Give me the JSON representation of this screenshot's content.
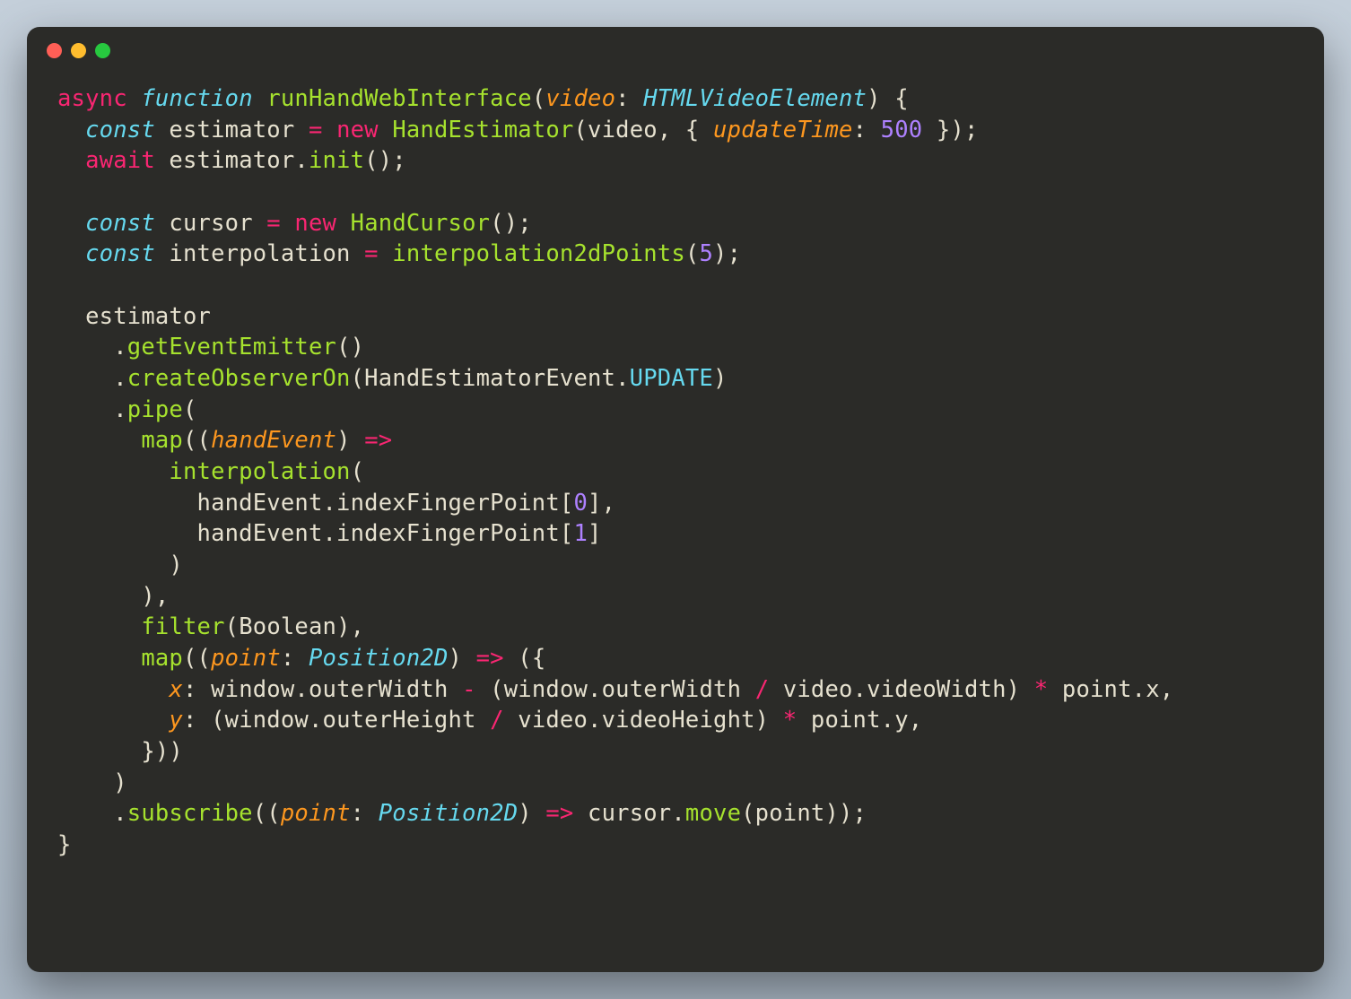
{
  "code": {
    "tokens": [
      {
        "t": "async",
        "c": "keyword"
      },
      {
        "t": " "
      },
      {
        "t": "function",
        "c": "keyword-blue"
      },
      {
        "t": " "
      },
      {
        "t": "runHandWebInterface",
        "c": "funcname"
      },
      {
        "t": "(",
        "c": "punc"
      },
      {
        "t": "video",
        "c": "param"
      },
      {
        "t": ": ",
        "c": "punc"
      },
      {
        "t": "HTMLVideoElement",
        "c": "type"
      },
      {
        "t": ")",
        "c": "punc"
      },
      {
        "t": " {",
        "c": "punc"
      },
      {
        "t": "\n"
      },
      {
        "t": "  "
      },
      {
        "t": "const",
        "c": "keyword-blue"
      },
      {
        "t": " estimator ",
        "c": "ident"
      },
      {
        "t": "=",
        "c": "op"
      },
      {
        "t": " "
      },
      {
        "t": "new",
        "c": "op"
      },
      {
        "t": " "
      },
      {
        "t": "HandEstimator",
        "c": "funcname"
      },
      {
        "t": "(video, { ",
        "c": "punc"
      },
      {
        "t": "updateTime",
        "c": "param"
      },
      {
        "t": ": ",
        "c": "punc"
      },
      {
        "t": "500",
        "c": "num"
      },
      {
        "t": " });",
        "c": "punc"
      },
      {
        "t": "\n"
      },
      {
        "t": "  "
      },
      {
        "t": "await",
        "c": "keyword"
      },
      {
        "t": " estimator.",
        "c": "ident"
      },
      {
        "t": "init",
        "c": "method"
      },
      {
        "t": "();",
        "c": "punc"
      },
      {
        "t": "\n"
      },
      {
        "t": "\n"
      },
      {
        "t": "  "
      },
      {
        "t": "const",
        "c": "keyword-blue"
      },
      {
        "t": " cursor ",
        "c": "ident"
      },
      {
        "t": "=",
        "c": "op"
      },
      {
        "t": " "
      },
      {
        "t": "new",
        "c": "op"
      },
      {
        "t": " "
      },
      {
        "t": "HandCursor",
        "c": "funcname"
      },
      {
        "t": "();",
        "c": "punc"
      },
      {
        "t": "\n"
      },
      {
        "t": "  "
      },
      {
        "t": "const",
        "c": "keyword-blue"
      },
      {
        "t": " interpolation ",
        "c": "ident"
      },
      {
        "t": "=",
        "c": "op"
      },
      {
        "t": " "
      },
      {
        "t": "interpolation2dPoints",
        "c": "method"
      },
      {
        "t": "(",
        "c": "punc"
      },
      {
        "t": "5",
        "c": "num"
      },
      {
        "t": ");",
        "c": "punc"
      },
      {
        "t": "\n"
      },
      {
        "t": "\n"
      },
      {
        "t": "  estimator",
        "c": "ident"
      },
      {
        "t": "\n"
      },
      {
        "t": "    .",
        "c": "punc"
      },
      {
        "t": "getEventEmitter",
        "c": "method"
      },
      {
        "t": "()",
        "c": "punc"
      },
      {
        "t": "\n"
      },
      {
        "t": "    .",
        "c": "punc"
      },
      {
        "t": "createObserverOn",
        "c": "method"
      },
      {
        "t": "(HandEstimatorEvent.",
        "c": "ident"
      },
      {
        "t": "UPDATE",
        "c": "const"
      },
      {
        "t": ")",
        "c": "punc"
      },
      {
        "t": "\n"
      },
      {
        "t": "    .",
        "c": "punc"
      },
      {
        "t": "pipe",
        "c": "method"
      },
      {
        "t": "(",
        "c": "punc"
      },
      {
        "t": "\n"
      },
      {
        "t": "      "
      },
      {
        "t": "map",
        "c": "method"
      },
      {
        "t": "((",
        "c": "punc"
      },
      {
        "t": "handEvent",
        "c": "param"
      },
      {
        "t": ") ",
        "c": "punc"
      },
      {
        "t": "=>",
        "c": "op"
      },
      {
        "t": "\n"
      },
      {
        "t": "        "
      },
      {
        "t": "interpolation",
        "c": "method"
      },
      {
        "t": "(",
        "c": "punc"
      },
      {
        "t": "\n"
      },
      {
        "t": "          handEvent.",
        "c": "ident"
      },
      {
        "t": "indexFingerPoint",
        "c": "prop"
      },
      {
        "t": "[",
        "c": "punc"
      },
      {
        "t": "0",
        "c": "num"
      },
      {
        "t": "],",
        "c": "punc"
      },
      {
        "t": "\n"
      },
      {
        "t": "          handEvent.",
        "c": "ident"
      },
      {
        "t": "indexFingerPoint",
        "c": "prop"
      },
      {
        "t": "[",
        "c": "punc"
      },
      {
        "t": "1",
        "c": "num"
      },
      {
        "t": "]",
        "c": "punc"
      },
      {
        "t": "\n"
      },
      {
        "t": "        )",
        "c": "punc"
      },
      {
        "t": "\n"
      },
      {
        "t": "      ),",
        "c": "punc"
      },
      {
        "t": "\n"
      },
      {
        "t": "      "
      },
      {
        "t": "filter",
        "c": "method"
      },
      {
        "t": "(Boolean),",
        "c": "punc"
      },
      {
        "t": "\n"
      },
      {
        "t": "      "
      },
      {
        "t": "map",
        "c": "method"
      },
      {
        "t": "((",
        "c": "punc"
      },
      {
        "t": "point",
        "c": "param"
      },
      {
        "t": ": ",
        "c": "punc"
      },
      {
        "t": "Position2D",
        "c": "type"
      },
      {
        "t": ") ",
        "c": "punc"
      },
      {
        "t": "=>",
        "c": "op"
      },
      {
        "t": " ({",
        "c": "punc"
      },
      {
        "t": "\n"
      },
      {
        "t": "        "
      },
      {
        "t": "x",
        "c": "param"
      },
      {
        "t": ": window.",
        "c": "ident"
      },
      {
        "t": "outerWidth",
        "c": "prop"
      },
      {
        "t": " ",
        "c": "punc"
      },
      {
        "t": "-",
        "c": "op"
      },
      {
        "t": " (window.",
        "c": "ident"
      },
      {
        "t": "outerWidth",
        "c": "prop"
      },
      {
        "t": " ",
        "c": "punc"
      },
      {
        "t": "/",
        "c": "op"
      },
      {
        "t": " video.",
        "c": "ident"
      },
      {
        "t": "videoWidth",
        "c": "prop"
      },
      {
        "t": ") ",
        "c": "punc"
      },
      {
        "t": "*",
        "c": "op"
      },
      {
        "t": " point.",
        "c": "ident"
      },
      {
        "t": "x",
        "c": "prop"
      },
      {
        "t": ",",
        "c": "punc"
      },
      {
        "t": "\n"
      },
      {
        "t": "        "
      },
      {
        "t": "y",
        "c": "param"
      },
      {
        "t": ": (window.",
        "c": "ident"
      },
      {
        "t": "outerHeight",
        "c": "prop"
      },
      {
        "t": " ",
        "c": "punc"
      },
      {
        "t": "/",
        "c": "op"
      },
      {
        "t": " video.",
        "c": "ident"
      },
      {
        "t": "videoHeight",
        "c": "prop"
      },
      {
        "t": ") ",
        "c": "punc"
      },
      {
        "t": "*",
        "c": "op"
      },
      {
        "t": " point.",
        "c": "ident"
      },
      {
        "t": "y",
        "c": "prop"
      },
      {
        "t": ",",
        "c": "punc"
      },
      {
        "t": "\n"
      },
      {
        "t": "      }))",
        "c": "punc"
      },
      {
        "t": "\n"
      },
      {
        "t": "    )",
        "c": "punc"
      },
      {
        "t": "\n"
      },
      {
        "t": "    .",
        "c": "punc"
      },
      {
        "t": "subscribe",
        "c": "method"
      },
      {
        "t": "((",
        "c": "punc"
      },
      {
        "t": "point",
        "c": "param"
      },
      {
        "t": ": ",
        "c": "punc"
      },
      {
        "t": "Position2D",
        "c": "type"
      },
      {
        "t": ") ",
        "c": "punc"
      },
      {
        "t": "=>",
        "c": "op"
      },
      {
        "t": " cursor.",
        "c": "ident"
      },
      {
        "t": "move",
        "c": "method"
      },
      {
        "t": "(point));",
        "c": "punc"
      },
      {
        "t": "\n"
      },
      {
        "t": "}",
        "c": "punc"
      }
    ]
  },
  "colors": {
    "background_outer": "#b6c2ce",
    "background_window": "#2b2b28",
    "dot_red": "#ff5f56",
    "dot_yellow": "#ffbd2e",
    "dot_green": "#27c93f"
  }
}
